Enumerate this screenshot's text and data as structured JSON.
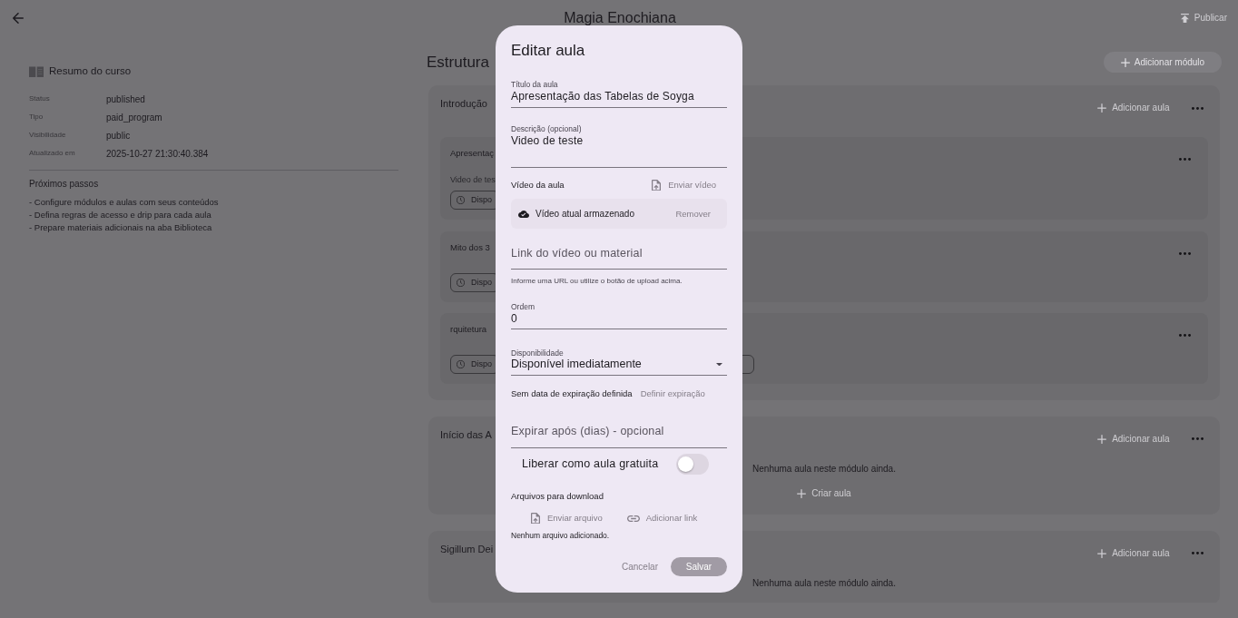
{
  "app_bar": {
    "title": "Magia Enochiana",
    "publish": {
      "label": "Publicar",
      "disabled": true
    }
  },
  "summary": {
    "title": "Resumo do curso",
    "rows": [
      {
        "label": "Status",
        "value": "published"
      },
      {
        "label": "Tipo",
        "value": "paid_program"
      },
      {
        "label": "Visibilidade",
        "value": "public"
      },
      {
        "label": "Atualizado em",
        "value": "2025-10-27 21:30:40.384"
      }
    ],
    "next_steps": {
      "title": "Próximos passos",
      "items": [
        "- Configure módulos e aulas com seus conteúdos",
        "- Defina regras de acesso e drip para cada aula",
        "- Prepare materiais adicionais na aba Biblioteca"
      ]
    }
  },
  "structure": {
    "title": "Estrutura",
    "add_module": {
      "label": "Adicionar módulo",
      "disabled": true
    },
    "modules": [
      {
        "title": "Introdução",
        "add_lesson": {
          "label": "Adicionar aula",
          "disabled": true
        },
        "lessons": [
          {
            "title": "Apresentaç",
            "subtitle": "Video de tes",
            "chips": [
              {
                "kind": "text",
                "label": "Dispo"
              }
            ]
          },
          {
            "title": "Mito dos 3",
            "chips": [
              {
                "kind": "text",
                "label": "Dispo"
              }
            ]
          },
          {
            "title": "rquitetura",
            "chips": [
              {
                "kind": "text",
                "label": "Dispo"
              },
              {
                "kind": "blank"
              }
            ]
          }
        ]
      },
      {
        "title": "Início das A",
        "add_lesson": {
          "label": "Adicionar aula",
          "disabled": true
        },
        "empty_text": "Nenhuma aula neste módulo ainda.",
        "create_lesson": {
          "label": "Criar aula",
          "disabled": true
        }
      },
      {
        "title": "Sigillum Dei",
        "add_lesson": {
          "label": "Adicionar aula",
          "disabled": true
        },
        "empty_text": "Nenhuma aula neste módulo ainda."
      }
    ]
  },
  "dialog": {
    "title": "Editar aula",
    "fields": [
      {
        "kind": "text",
        "label": "Título da aula",
        "value": "Apresentação das Tabelas de Soyga"
      },
      {
        "kind": "multiline",
        "label": "Descrição (opcional)",
        "value": "Video de teste"
      }
    ],
    "video": {
      "label": "Vídeo da aula",
      "upload": {
        "label": "Enviar vídeo",
        "disabled": true
      },
      "stored": {
        "text": "Vídeo atual armazenado",
        "remove": {
          "label": "Remover",
          "disabled": true
        }
      }
    },
    "link_field": {
      "placeholder": "Link do vídeo ou material",
      "helper": "Informe uma URL ou utilize o botão de upload acima."
    },
    "order_field": {
      "label": "Ordem",
      "value": "0"
    },
    "availability": {
      "label": "Disponibilidade",
      "value": "Disponível imediatamente"
    },
    "expiration": {
      "text": "Sem data de expiração definida",
      "define": {
        "label": "Definir expiração",
        "disabled": true
      }
    },
    "expire_days_field": {
      "placeholder": "Expirar após (dias) - opcional"
    },
    "free_toggle": {
      "label": "Liberar como aula gratuita",
      "on": false
    },
    "downloads": {
      "title": "Arquivos para download",
      "upload": {
        "label": "Enviar arquivo",
        "disabled": true
      },
      "add_link": {
        "label": "Adicionar link",
        "disabled": true
      },
      "empty_text": "Nenhum arquivo adicionado."
    },
    "actions": {
      "cancel": {
        "label": "Cancelar",
        "disabled": true
      },
      "save": {
        "label": "Salvar",
        "disabled": true
      }
    }
  }
}
